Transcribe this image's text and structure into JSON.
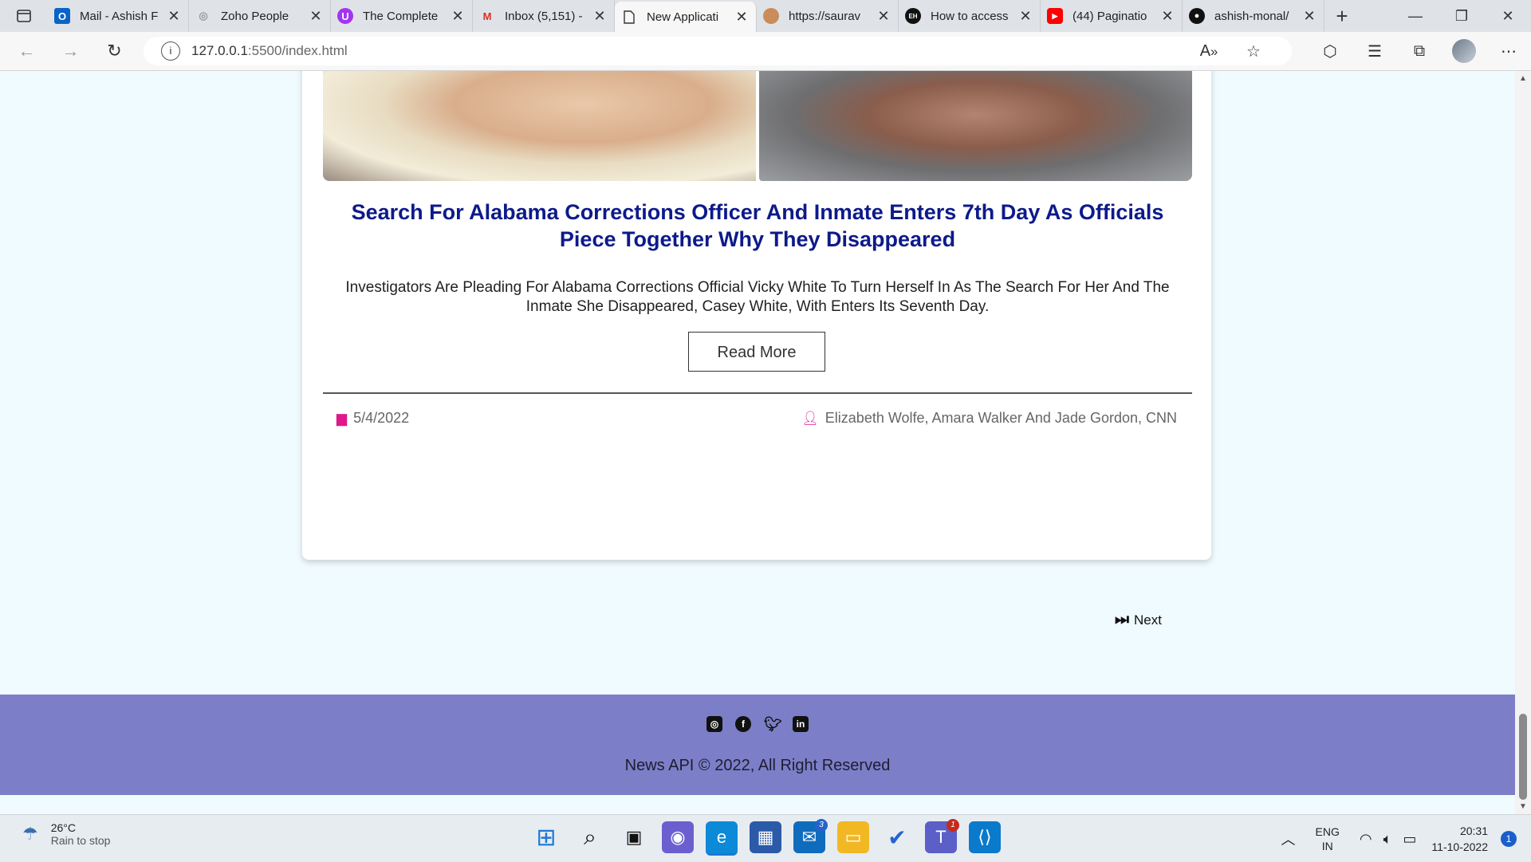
{
  "browser": {
    "tabs": [
      {
        "title": "Mail - Ashish F",
        "icon": "outlook-icon"
      },
      {
        "title": "Zoho People",
        "icon": "zoho-icon"
      },
      {
        "title": "The Complete",
        "icon": "udemy-icon"
      },
      {
        "title": "Inbox (5,151) -",
        "icon": "gmail-icon"
      },
      {
        "title": "New Applicati",
        "icon": "page-icon",
        "active": true
      },
      {
        "title": "https://saurav",
        "icon": "avatar-icon"
      },
      {
        "title": "How to access",
        "icon": "eh-icon"
      },
      {
        "title": "(44) Paginatio",
        "icon": "youtube-icon"
      },
      {
        "title": "ashish-monal/",
        "icon": "github-icon"
      }
    ],
    "url_host": "127.0.0.1",
    "url_path": ":5500/index.html"
  },
  "article": {
    "headline": "Search For Alabama Corrections Officer And Inmate Enters 7th Day As Officials Piece Together Why They Disappeared",
    "description": "Investigators Are Pleading For Alabama Corrections Official Vicky White To Turn Herself In As The Search For Her And The Inmate She Disappeared, Casey White, With Enters Its Seventh Day.",
    "read_more": "Read More",
    "date": "5/4/2022",
    "author": "Elizabeth Wolfe, Amara Walker And Jade Gordon, CNN"
  },
  "pagination": {
    "next": "Next"
  },
  "footer": {
    "copyright": "News API © 2022, All Right Reserved",
    "socials": [
      "instagram-icon",
      "facebook-icon",
      "twitter-icon",
      "linkedin-icon"
    ]
  },
  "taskbar": {
    "weather_temp": "26°C",
    "weather_desc": "Rain to stop",
    "lang_1": "ENG",
    "lang_2": "IN",
    "time": "20:31",
    "date": "11-10-2022",
    "notifications": "1",
    "mail_badge": "3",
    "teams_badge": "1"
  },
  "colors": {
    "headline": "#0d1a8a",
    "accent_pink": "#e0178c",
    "footer_bg": "#7c7fc7",
    "page_bg": "#f0fbff"
  }
}
